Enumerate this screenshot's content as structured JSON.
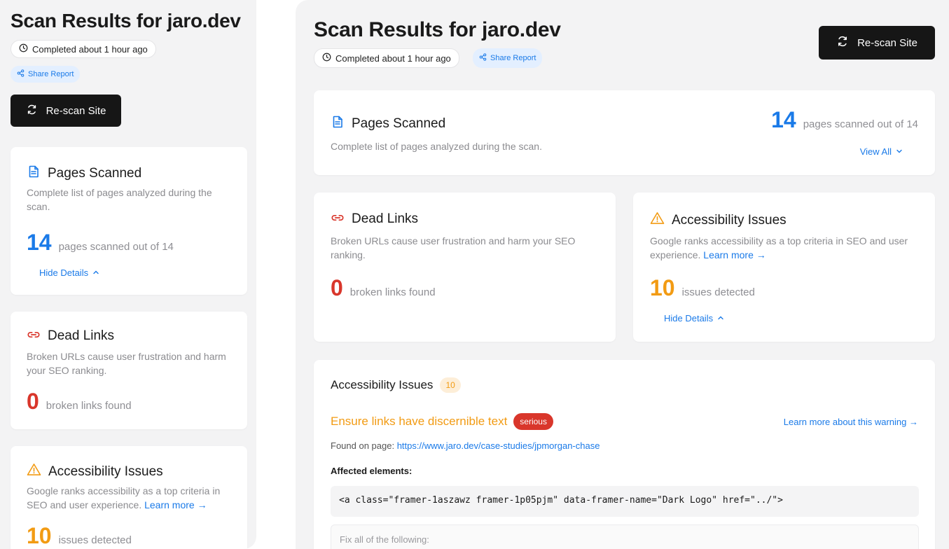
{
  "colors": {
    "accent_blue": "#1a7ae8",
    "dead_red": "#d9362b",
    "warn_orange": "#f29b13",
    "button_dark": "#161616",
    "panel_bg": "#f3f3f4"
  },
  "header": {
    "title": "Scan Results for jaro.dev",
    "completed": "Completed about 1 hour ago",
    "share": "Share Report",
    "rescan": "Re-scan Site"
  },
  "pages_card": {
    "title": "Pages Scanned",
    "description": "Complete list of pages analyzed during the scan.",
    "count": "14",
    "count_label": "pages scanned out of 14",
    "view_all": "View All",
    "hide_details": "Hide Details"
  },
  "dead_links_card": {
    "title": "Dead Links",
    "description": "Broken URLs cause user frustration and harm your SEO ranking.",
    "count": "0",
    "count_label": "broken links found"
  },
  "accessibility_card": {
    "title": "Accessibility Issues",
    "description": "Google ranks accessibility as a top criteria in SEO and user experience.",
    "learn_more": "Learn more →",
    "count": "10",
    "count_label": "issues detected",
    "hide_details": "Hide Details"
  },
  "issues_list": {
    "title": "Accessibility Issues",
    "count": "10",
    "issue_title": "Ensure links have discernible text",
    "severity": "serious",
    "learn_more_warning": "Learn more about this warning →",
    "found_on_label": "Found on page:",
    "found_on_url": "https://www.jaro.dev/case-studies/jpmorgan-chase",
    "affected_label": "Affected elements:",
    "code": "<a class=\"framer-1aszawz framer-1p05pjm\" data-framer-name=\"Dark Logo\" href=\"../\">",
    "fix_label": "Fix all of the following:"
  }
}
